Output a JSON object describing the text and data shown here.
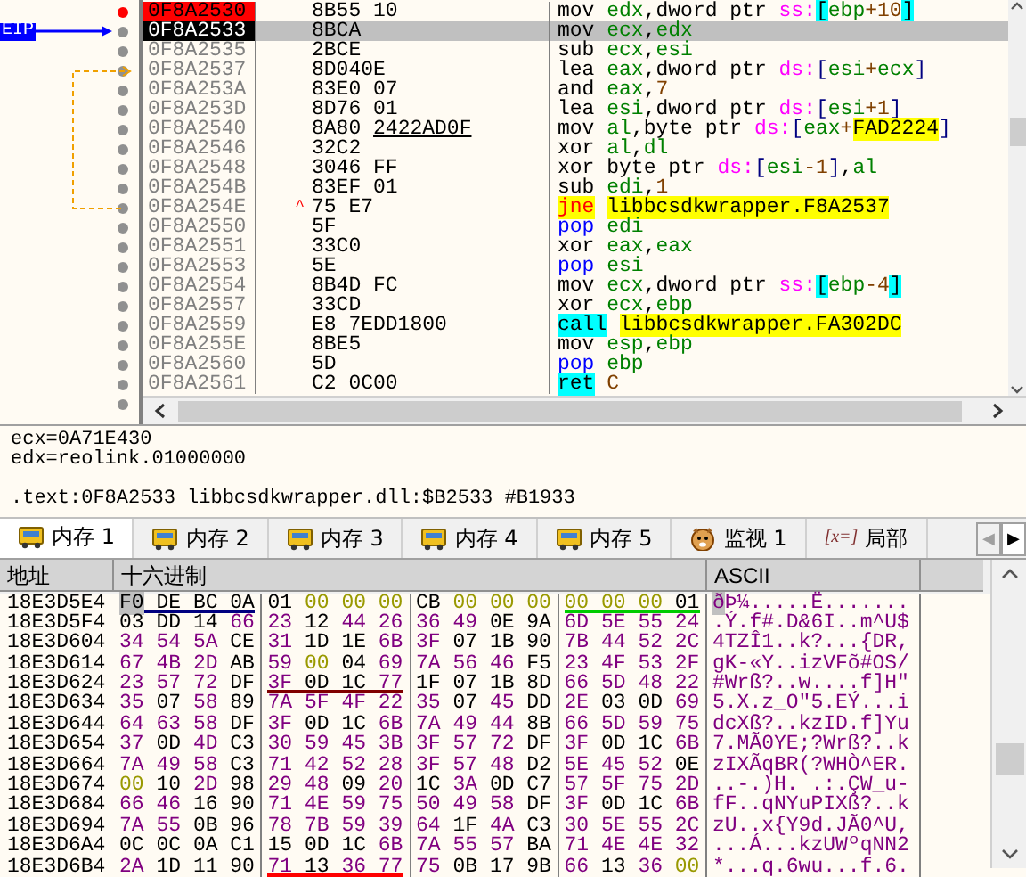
{
  "disassembly": {
    "eip_label": "EIP",
    "rows": [
      {
        "address": "0F8A2530",
        "bytes": "8B55 10",
        "mnemonic": "mov",
        "operands": "edx,dword ptr ss:[ebp+10]",
        "kind": "normal",
        "breakpoint": true,
        "current": false,
        "selected": false
      },
      {
        "address": "0F8A2533",
        "bytes": "8BCA",
        "mnemonic": "mov",
        "operands": "ecx,edx",
        "kind": "normal",
        "breakpoint": false,
        "current": true,
        "selected": true
      },
      {
        "address": "0F8A2535",
        "bytes": "2BCE",
        "mnemonic": "sub",
        "operands": "ecx,esi",
        "kind": "normal",
        "breakpoint": false,
        "current": false,
        "selected": false
      },
      {
        "address": "0F8A2537",
        "bytes": "8D040E",
        "mnemonic": "lea",
        "operands": "eax,dword ptr ds:[esi+ecx]",
        "kind": "normal",
        "breakpoint": false,
        "current": false,
        "selected": false,
        "jump_in": true
      },
      {
        "address": "0F8A253A",
        "bytes": "83E0 07",
        "mnemonic": "and",
        "operands": "eax,7",
        "kind": "normal",
        "breakpoint": false,
        "current": false,
        "selected": false
      },
      {
        "address": "0F8A253D",
        "bytes": "8D76 01",
        "mnemonic": "lea",
        "operands": "esi,dword ptr ds:[esi+1]",
        "kind": "normal",
        "breakpoint": false,
        "current": false,
        "selected": false
      },
      {
        "address": "0F8A2540",
        "bytes": "8A80 2422AD0F",
        "underline_last": true,
        "mnemonic": "mov",
        "operands": "al,byte ptr ds:[eax+FAD2224]",
        "kind": "normal",
        "breakpoint": false,
        "current": false,
        "selected": false
      },
      {
        "address": "0F8A2546",
        "bytes": "32C2",
        "mnemonic": "xor",
        "operands": "al,dl",
        "kind": "normal",
        "breakpoint": false,
        "current": false,
        "selected": false
      },
      {
        "address": "0F8A2548",
        "bytes": "3046 FF",
        "mnemonic": "xor",
        "operands": "byte ptr ds:[esi-1],al",
        "kind": "normal",
        "breakpoint": false,
        "current": false,
        "selected": false
      },
      {
        "address": "0F8A254B",
        "bytes": "83EF 01",
        "mnemonic": "sub",
        "operands": "edi,1",
        "kind": "normal",
        "breakpoint": false,
        "current": false,
        "selected": false
      },
      {
        "address": "0F8A254E",
        "mark": "^",
        "bytes": "75 E7",
        "mnemonic": "jne",
        "operands": "libbcsdkwrapper.F8A2537",
        "kind": "jcc",
        "breakpoint": false,
        "current": false,
        "selected": false
      },
      {
        "address": "0F8A2550",
        "bytes": "5F",
        "mnemonic": "pop",
        "operands": "edi",
        "kind": "stack",
        "breakpoint": false,
        "current": false,
        "selected": false
      },
      {
        "address": "0F8A2551",
        "bytes": "33C0",
        "mnemonic": "xor",
        "operands": "eax,eax",
        "kind": "normal",
        "breakpoint": false,
        "current": false,
        "selected": false
      },
      {
        "address": "0F8A2553",
        "bytes": "5E",
        "mnemonic": "pop",
        "operands": "esi",
        "kind": "stack",
        "breakpoint": false,
        "current": false,
        "selected": false
      },
      {
        "address": "0F8A2554",
        "bytes": "8B4D FC",
        "mnemonic": "mov",
        "operands": "ecx,dword ptr ss:[ebp-4]",
        "kind": "normal",
        "breakpoint": false,
        "current": false,
        "selected": false
      },
      {
        "address": "0F8A2557",
        "bytes": "33CD",
        "mnemonic": "xor",
        "operands": "ecx,ebp",
        "kind": "normal",
        "breakpoint": false,
        "current": false,
        "selected": false
      },
      {
        "address": "0F8A2559",
        "bytes": "E8 7EDD1800",
        "mnemonic": "call",
        "operands": "libbcsdkwrapper.FA302DC",
        "kind": "call",
        "breakpoint": false,
        "current": false,
        "selected": false
      },
      {
        "address": "0F8A255E",
        "bytes": "8BE5",
        "mnemonic": "mov",
        "operands": "esp,ebp",
        "kind": "normal",
        "breakpoint": false,
        "current": false,
        "selected": false
      },
      {
        "address": "0F8A2560",
        "bytes": "5D",
        "mnemonic": "pop",
        "operands": "ebp",
        "kind": "stack",
        "breakpoint": false,
        "current": false,
        "selected": false
      },
      {
        "address": "0F8A2561",
        "bytes": "C2 0C00",
        "mnemonic": "ret",
        "operands": "C",
        "kind": "ret",
        "breakpoint": false,
        "current": false,
        "selected": false
      }
    ]
  },
  "info": {
    "registers": [
      "ecx=0A71E430",
      "edx=reolink.01000000"
    ],
    "location": ".text:0F8A2533 libbcsdkwrapper.dll:$B2533 #B1933"
  },
  "tabs": [
    {
      "kind": "memory",
      "label": "内存 1",
      "selected": true
    },
    {
      "kind": "memory",
      "label": "内存 2",
      "selected": false
    },
    {
      "kind": "memory",
      "label": "内存 3",
      "selected": false
    },
    {
      "kind": "memory",
      "label": "内存 4",
      "selected": false
    },
    {
      "kind": "memory",
      "label": "内存 5",
      "selected": false
    },
    {
      "kind": "watch",
      "label": "监视 1",
      "selected": false
    },
    {
      "kind": "locals",
      "icon_text": "[x=]",
      "label": "局部",
      "selected": false
    }
  ],
  "tab_scroll": {
    "left": "◀",
    "right": "▶"
  },
  "dump": {
    "columns": [
      "地址",
      "十六进制",
      "ASCII"
    ],
    "rows": [
      {
        "address": "18E3D5E4",
        "cursor": true,
        "groups": [
          {
            "bytes": "F0 DE BC 0A",
            "color": "#000080"
          },
          {
            "bytes": "01 00 00 00"
          },
          {
            "bytes": "CB 00 00 00"
          },
          {
            "bytes": "00 00 00 01",
            "color": "#00cc00"
          }
        ],
        "ascii": "ðÞ¼.....Ë......."
      },
      {
        "address": "18E3D5F4",
        "cursor": false,
        "groups": [
          {
            "bytes": "03 DD 14 66"
          },
          {
            "bytes": "23 12 44 26"
          },
          {
            "bytes": "36 49 0E 9A"
          },
          {
            "bytes": "6D 5E 55 24"
          }
        ],
        "ascii": ".Ý.f#.D&6I..m^U$"
      },
      {
        "address": "18E3D604",
        "cursor": false,
        "groups": [
          {
            "bytes": "34 54 5A CE"
          },
          {
            "bytes": "31 1D 1E 6B"
          },
          {
            "bytes": "3F 07 1B 90"
          },
          {
            "bytes": "7B 44 52 2C"
          }
        ],
        "ascii": "4TZÎ1..k?...{DR,"
      },
      {
        "address": "18E3D614",
        "cursor": false,
        "groups": [
          {
            "bytes": "67 4B 2D AB"
          },
          {
            "bytes": "59 00 04 69"
          },
          {
            "bytes": "7A 56 46 F5"
          },
          {
            "bytes": "23 4F 53 2F"
          }
        ],
        "ascii": "gK-«Y..izVFõ#OS/"
      },
      {
        "address": "18E3D624",
        "cursor": false,
        "groups": [
          {
            "bytes": "23 57 72 DF"
          },
          {
            "bytes": "3F 0D 1C 77",
            "color": "#800000"
          },
          {
            "bytes": "1F 07 1B 8D"
          },
          {
            "bytes": "66 5D 48 22"
          }
        ],
        "ascii": "#Wrß?..w....f]H\""
      },
      {
        "address": "18E3D634",
        "cursor": false,
        "groups": [
          {
            "bytes": "35 07 58 89"
          },
          {
            "bytes": "7A 5F 4F 22"
          },
          {
            "bytes": "35 07 45 DD"
          },
          {
            "bytes": "2E 03 0D 69"
          }
        ],
        "ascii": "5.X.z_O\"5.EÝ...i"
      },
      {
        "address": "18E3D644",
        "cursor": false,
        "groups": [
          {
            "bytes": "64 63 58 DF"
          },
          {
            "bytes": "3F 0D 1C 6B"
          },
          {
            "bytes": "7A 49 44 8B"
          },
          {
            "bytes": "66 5D 59 75"
          }
        ],
        "ascii": "dcXß?..kzID.f]Yu"
      },
      {
        "address": "18E3D654",
        "cursor": false,
        "groups": [
          {
            "bytes": "37 0D 4D C3"
          },
          {
            "bytes": "30 59 45 3B"
          },
          {
            "bytes": "3F 57 72 DF"
          },
          {
            "bytes": "3F 0D 1C 6B"
          }
        ],
        "ascii": "7.MÃ0YE;?Wrß?..k"
      },
      {
        "address": "18E3D664",
        "cursor": false,
        "groups": [
          {
            "bytes": "7A 49 58 C3"
          },
          {
            "bytes": "71 42 52 28"
          },
          {
            "bytes": "3F 57 48 D2"
          },
          {
            "bytes": "5E 45 52 0E"
          }
        ],
        "ascii": "zIXÃqBR(?WHÒ^ER."
      },
      {
        "address": "18E3D674",
        "cursor": false,
        "groups": [
          {
            "bytes": "00 10 2D 98"
          },
          {
            "bytes": "29 48 09 20"
          },
          {
            "bytes": "1C 3A 0D C7"
          },
          {
            "bytes": "57 5F 75 2D"
          }
        ],
        "ascii": "..-.)H. .:.ÇW_u-"
      },
      {
        "address": "18E3D684",
        "cursor": false,
        "groups": [
          {
            "bytes": "66 46 16 90"
          },
          {
            "bytes": "71 4E 59 75"
          },
          {
            "bytes": "50 49 58 DF"
          },
          {
            "bytes": "3F 0D 1C 6B"
          }
        ],
        "ascii": "fF..qNYuPIXß?..k"
      },
      {
        "address": "18E3D694",
        "cursor": false,
        "groups": [
          {
            "bytes": "7A 55 0B 96"
          },
          {
            "bytes": "78 7B 59 39"
          },
          {
            "bytes": "64 1F 4A C3"
          },
          {
            "bytes": "30 5E 55 2C"
          }
        ],
        "ascii": "zU..x{Y9d.JÃ0^U,"
      },
      {
        "address": "18E3D6A4",
        "cursor": false,
        "groups": [
          {
            "bytes": "0C 0C 0A C1"
          },
          {
            "bytes": "15 0D 1C 6B"
          },
          {
            "bytes": "7A 55 57 BA"
          },
          {
            "bytes": "71 4E 4E 32"
          }
        ],
        "ascii": "...Á...kzUWºqNN2"
      },
      {
        "address": "18E3D6B4",
        "cursor": false,
        "groups": [
          {
            "bytes": "2A 1D 11 90"
          },
          {
            "bytes": "71 13 36 77",
            "color": "#ff0000"
          },
          {
            "bytes": "75 0B 17 9B"
          },
          {
            "bytes": "66 13 36 00"
          }
        ],
        "ascii": "*...q.6wu...f.6."
      }
    ]
  }
}
